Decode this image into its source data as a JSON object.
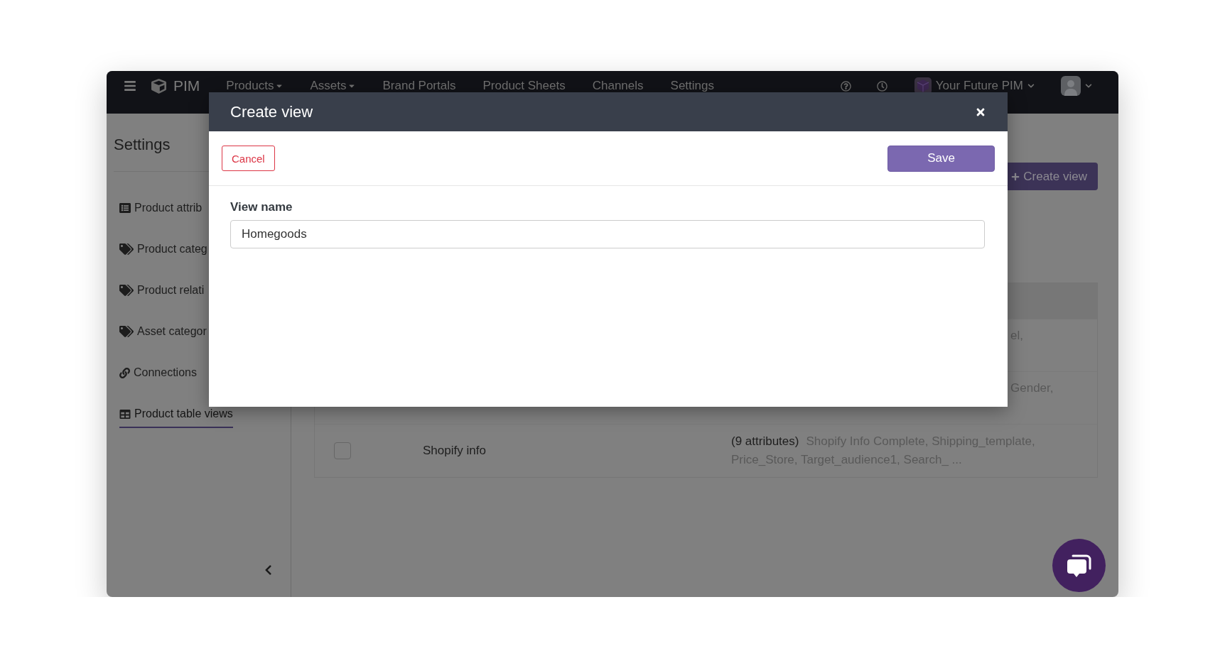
{
  "nav": {
    "brand": "PIM",
    "menu": [
      {
        "label": "Products",
        "has_menu": true
      },
      {
        "label": "Assets",
        "has_menu": true
      },
      {
        "label": "Brand Portals",
        "has_menu": false
      },
      {
        "label": "Product Sheets",
        "has_menu": false
      },
      {
        "label": "Channels",
        "has_menu": false
      },
      {
        "label": "Settings",
        "has_menu": false
      }
    ],
    "workspace": "Your Future PIM"
  },
  "sidebar": {
    "title": "Settings",
    "items": [
      {
        "label": "Product attrib",
        "kind": "list",
        "selected": false
      },
      {
        "label": "Product categ",
        "kind": "tag",
        "selected": false
      },
      {
        "label": "Product relati",
        "kind": "tag",
        "selected": false
      },
      {
        "label": "Asset categor",
        "kind": "tag",
        "selected": false
      },
      {
        "label": "Connections",
        "kind": "link",
        "selected": false
      },
      {
        "label": "Product table views",
        "kind": "table",
        "selected": true
      }
    ]
  },
  "main": {
    "create_button": "Create view",
    "table": {
      "rows": [
        {
          "attributes": "el,"
        },
        {
          "attributes": "Gender,"
        },
        {
          "checked": false,
          "name": "Shopify info",
          "attribute_count": "(9 attributes)",
          "attributes": "Shopify Info Complete, Shipping_template, Price_Store, Target_audience1, Search_ ..."
        }
      ]
    }
  },
  "modal": {
    "title": "Create view",
    "cancel": "Cancel",
    "save": "Save",
    "field": {
      "label": "View name",
      "value": "Homegoods"
    }
  }
}
